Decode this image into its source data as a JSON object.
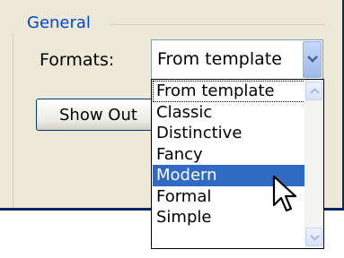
{
  "group": {
    "label": "General"
  },
  "formats": {
    "label": "Formats:",
    "value": "From template"
  },
  "show_button": {
    "label": "Show Out"
  },
  "dropdown": {
    "items": [
      {
        "label": "From template"
      },
      {
        "label": "Classic"
      },
      {
        "label": "Distinctive"
      },
      {
        "label": "Fancy"
      },
      {
        "label": "Modern"
      },
      {
        "label": "Formal"
      },
      {
        "label": "Simple"
      }
    ],
    "selected": "Modern"
  },
  "colors": {
    "group_label": "#0046d5",
    "selection": "#316ac5",
    "dialog_bg": "#ece9d8",
    "accent_line": "#0a246a"
  },
  "icons": {
    "combo_arrow": "chevron-down-icon",
    "scroll_up": "scroll-up-arrow-icon",
    "scroll_down": "scroll-down-arrow-icon",
    "cursor": "mouse-pointer-icon"
  }
}
